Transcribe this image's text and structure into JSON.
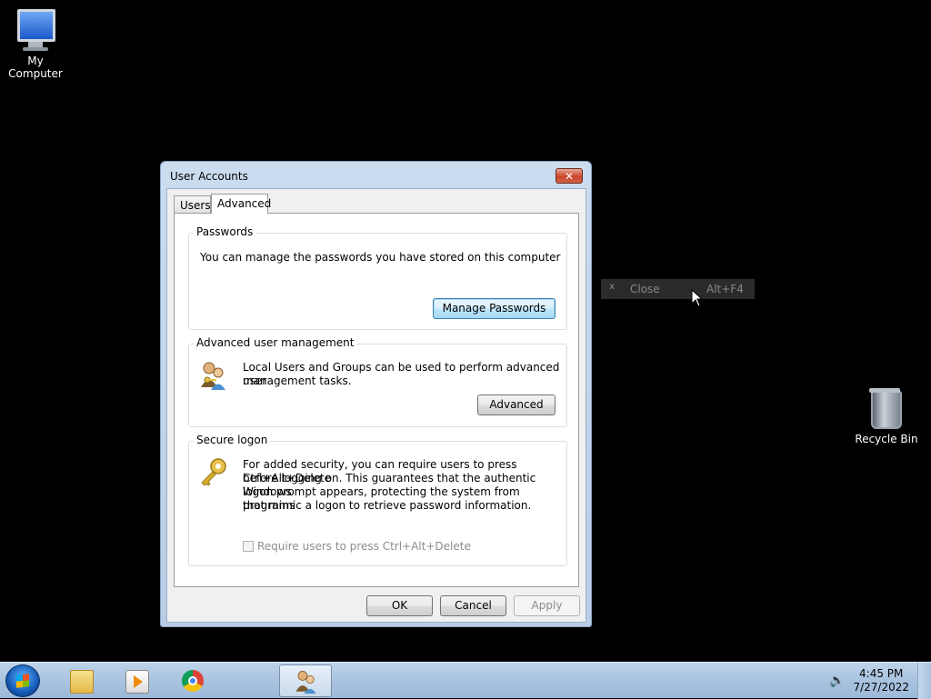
{
  "desktop": {
    "icons": [
      {
        "label": "My Computer"
      },
      {
        "label": "Recycle Bin"
      }
    ]
  },
  "context_menu": {
    "item_label": "Close",
    "item_shortcut": "Alt+F4"
  },
  "dialog": {
    "title": "User Accounts",
    "tabs": [
      {
        "label": "Users"
      },
      {
        "label": "Advanced"
      }
    ],
    "active_tab": "Advanced",
    "passwords": {
      "heading": "Passwords",
      "description": "You can manage the passwords you have stored on this computer",
      "button": "Manage Passwords"
    },
    "advanced_mgmt": {
      "heading": "Advanced user management",
      "description_line1": "Local Users and Groups can be used to perform advanced user",
      "description_line2": "management tasks.",
      "button": "Advanced"
    },
    "secure_logon": {
      "heading": "Secure logon",
      "line1": "For added security, you can require users to press Ctrl+Alt+Delete",
      "line2": "before logging on. This guarantees that the authentic Windows",
      "line3": "logon prompt appears, protecting the system from programs",
      "line4": "that mimic a logon to retrieve password information.",
      "checkbox_label": "Require users to press Ctrl+Alt+Delete",
      "checkbox_checked": false
    },
    "buttons": {
      "ok": "OK",
      "cancel": "Cancel",
      "apply": "Apply"
    }
  },
  "taskbar": {
    "clock_time": "4:45 PM",
    "clock_date": "7/27/2022"
  }
}
